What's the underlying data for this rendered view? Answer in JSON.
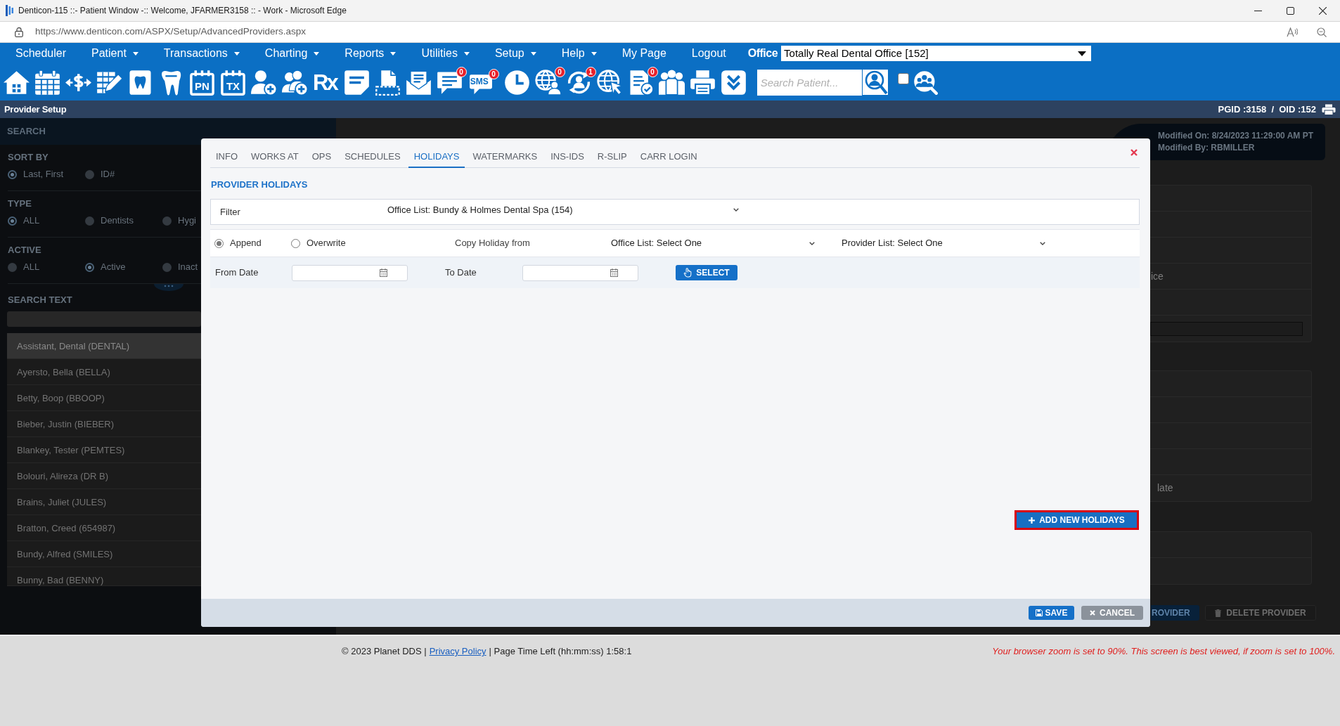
{
  "window": {
    "title": "Denticon-115 ::- Patient Window -:: Welcome, JFARMER3158 :: - Work - Microsoft Edge"
  },
  "address_bar": {
    "url": "https://www.denticon.com/ASPX/Setup/AdvancedProviders.aspx"
  },
  "menu": [
    {
      "label": "Scheduler",
      "has_menu": false
    },
    {
      "label": "Patient",
      "has_menu": true
    },
    {
      "label": "Transactions",
      "has_menu": true
    },
    {
      "label": "Charting",
      "has_menu": true
    },
    {
      "label": "Reports",
      "has_menu": true
    },
    {
      "label": "Utilities",
      "has_menu": true
    },
    {
      "label": "Setup",
      "has_menu": true
    },
    {
      "label": "Help",
      "has_menu": true
    },
    {
      "label": "My Page",
      "has_menu": false
    },
    {
      "label": "Logout",
      "has_menu": false
    }
  ],
  "office": {
    "label": "Office",
    "value": "Totally Real Dental Office [152]"
  },
  "toolbar": {
    "icon_labels": [
      "PN",
      "TX",
      "Rx",
      "SMS"
    ],
    "badges": [
      "0",
      "0",
      "0",
      "1",
      "0"
    ],
    "search": {
      "placeholder": "Search Patient..."
    },
    "checkbox": {
      "checked": false
    }
  },
  "page_header": {
    "title": "Provider Setup",
    "ids": "PGID :3158  /  OID :152"
  },
  "sidebar": {
    "heading": "SEARCH",
    "groups": [
      {
        "title": "SORT BY",
        "options": [
          {
            "label": "Last, First",
            "selected": true
          },
          {
            "label": "ID#",
            "selected": false
          }
        ]
      },
      {
        "title": "TYPE",
        "options": [
          {
            "label": "ALL",
            "selected": true
          },
          {
            "label": "Dentists",
            "selected": false
          },
          {
            "label": "Hygi",
            "selected": false
          }
        ]
      },
      {
        "title": "ACTIVE",
        "options": [
          {
            "label": "ALL",
            "selected": false
          },
          {
            "label": "Active",
            "selected": true
          },
          {
            "label": "Inact",
            "selected": false
          }
        ]
      }
    ],
    "search_label": "SEARCH TEXT",
    "providers": [
      {
        "name": "Assistant, Dental (DENTAL)",
        "selected": true
      },
      {
        "name": "Ayersto, Bella (BELLA)",
        "selected": false
      },
      {
        "name": "Betty, Boop (BBOOP)",
        "selected": false
      },
      {
        "name": "Bieber, Justin (BIEBER)",
        "selected": false
      },
      {
        "name": "Blankey, Tester (PEMTES)",
        "selected": false
      },
      {
        "name": "Bolouri, Alireza (DR B)",
        "selected": false
      },
      {
        "name": "Brains, Juliet (JULES)",
        "selected": false
      },
      {
        "name": "Bratton, Creed (654987)",
        "selected": false
      },
      {
        "name": "Bundy, Alfred (SMILES)",
        "selected": false
      },
      {
        "name": "Bunny, Bad (BENNY)",
        "selected": false
      }
    ]
  },
  "details": {
    "modified_on": "Modified On: 8/24/2023 11:29:00 AM PT",
    "modified_by": "Modified By: RBMILLER",
    "label_fragments": [
      "ice",
      "late"
    ],
    "buttons": [
      {
        "label": "ROVIDER",
        "kind": "primary"
      },
      {
        "label": "DELETE PROVIDER",
        "kind": "delete"
      }
    ]
  },
  "dialog": {
    "tabs": [
      {
        "label": "INFO",
        "selected": false
      },
      {
        "label": "WORKS AT",
        "selected": false
      },
      {
        "label": "OPS",
        "selected": false
      },
      {
        "label": "SCHEDULES",
        "selected": false
      },
      {
        "label": "HOLIDAYS",
        "selected": true
      },
      {
        "label": "WATERMARKS",
        "selected": false
      },
      {
        "label": "INS-IDS",
        "selected": false
      },
      {
        "label": "R-SLIP",
        "selected": false
      },
      {
        "label": "CARR LOGIN",
        "selected": false
      }
    ],
    "section_title": "PROVIDER HOLIDAYS",
    "filter": {
      "label": "Filter",
      "value": "Office List: Bundy & Holmes Dental Spa (154)"
    },
    "modes": [
      {
        "label": "Append",
        "selected": true
      },
      {
        "label": "Overwrite",
        "selected": false
      }
    ],
    "copy_label": "Copy Holiday from",
    "copy_sources": [
      {
        "value": "Office List: Select One"
      },
      {
        "value": "Provider List: Select One"
      }
    ],
    "date_fields": [
      {
        "label": "From Date"
      },
      {
        "label": "To Date"
      }
    ],
    "select_button": "SELECT",
    "add_button": {
      "label": "ADD NEW HOLIDAYS",
      "highlighted": true
    },
    "actions": [
      {
        "label": "SAVE",
        "kind": "save"
      },
      {
        "label": "CANCEL",
        "kind": "cancel"
      }
    ]
  },
  "footer": {
    "copyright": "© 2023 Planet DDS |",
    "privacy_link": "Privacy Policy",
    "session": "| Page Time Left (hh:mm:ss) 1:58:1",
    "zoom_warning": "Your browser zoom is set to 90%. This screen is best viewed, if zoom is set to 100%."
  }
}
